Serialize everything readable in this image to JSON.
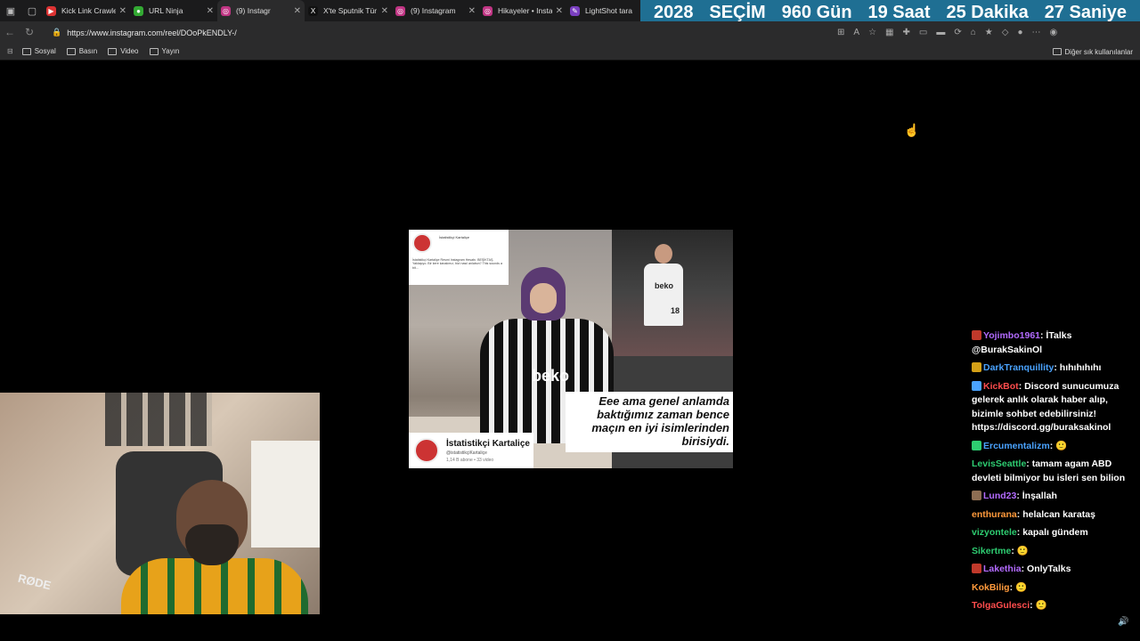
{
  "browser": {
    "tabs": [
      {
        "label": "Kick Link Crawle",
        "fav_color": "#d33",
        "fav": "▶"
      },
      {
        "label": "URL Ninja",
        "fav_color": "#3a3",
        "fav": "●"
      },
      {
        "label": "(9) Instagr",
        "fav_color": "#c13584",
        "fav": "◎"
      },
      {
        "label": "X'te Sputnik Tür",
        "fav_color": "#111",
        "fav": "X"
      },
      {
        "label": "(9) Instagram",
        "fav_color": "#c13584",
        "fav": "◎"
      },
      {
        "label": "Hikayeler • Insta",
        "fav_color": "#c13584",
        "fav": "◎"
      },
      {
        "label": "LightShot tara",
        "fav_color": "#7a3fc0",
        "fav": "✎"
      }
    ],
    "url": "https://www.instagram.com/reel/DOoPkENDLY-/",
    "bookmarks": [
      "Sosyal",
      "Basın",
      "Video",
      "Yayın"
    ],
    "other_bookmarks": "Diğer sık kullanılanlar"
  },
  "counter": {
    "year": "2028",
    "label": "SEÇİM",
    "days": "960 Gün",
    "hours": "19 Saat",
    "minutes": "25 Dakika",
    "seconds": "27 Saniye"
  },
  "video": {
    "caption": "Eee ama genel anlamda baktığımız zaman bence maçın en iyi isimlerinden birisiydi.",
    "channel_name": "İstatistikçi Kartaliçe",
    "channel_handle": "@istatistikçiKartaliçe",
    "channel_stats": "1,14 B abone • 33 video",
    "card_name": "İstatistikçi Kartaliçe",
    "card_bio": "İstatistikçi Kartaliçe Resmi Instagram Hesabı. BEŞİKTAŞ. Yaklaşıyo. Bir kere kanalımız, bizi nasıl anlatsın? This sounds a bit...",
    "jersey_brand": "beko",
    "player_number": "18"
  },
  "webcam": {
    "mic_brand": "RØDE"
  },
  "chat": [
    {
      "user": "Yojimbo1961",
      "color": "#b36bff",
      "badge": "#c0392b",
      "text": "İTalks @BurakSakinOl"
    },
    {
      "user": "DarkTranquillity",
      "color": "#4aa3ff",
      "badge": "#d4a017",
      "text": "hıhıhıhıhı"
    },
    {
      "user": "KickBot",
      "color": "#ff4d4d",
      "badge": "#4aa3ff",
      "text": "Discord sunucumuza gelerek anlık olarak haber alıp, bizimle sohbet edebilirsiniz! https://discord.gg/buraksakinol"
    },
    {
      "user": "Ercumentalizm",
      "color": "#4aa3ff",
      "badge": "#2ecc71",
      "text": "🙂"
    },
    {
      "user": "LevisSeattle",
      "color": "#2ecc71",
      "badge": "",
      "text": "tamam agam ABD devleti bilmiyor bu isleri sen bilion"
    },
    {
      "user": "Lund23",
      "color": "#b36bff",
      "badge": "#8e6e53",
      "text": "İnşallah"
    },
    {
      "user": "enthurana",
      "color": "#ff9a3c",
      "badge": "",
      "text": "helalcan karataş"
    },
    {
      "user": "vizyontele",
      "color": "#2ecc71",
      "badge": "",
      "text": "kapalı gündem"
    },
    {
      "user": "Sikertme",
      "color": "#2ecc71",
      "badge": "",
      "text": "🙂"
    },
    {
      "user": "Lakethia",
      "color": "#b36bff",
      "badge": "#c0392b",
      "text": "OnlyTalks"
    },
    {
      "user": "KokBilig",
      "color": "#ff9a3c",
      "badge": "",
      "text": "🙂"
    },
    {
      "user": "TolgaGulesci",
      "color": "#ff4d4d",
      "badge": "",
      "text": "🙂"
    }
  ]
}
